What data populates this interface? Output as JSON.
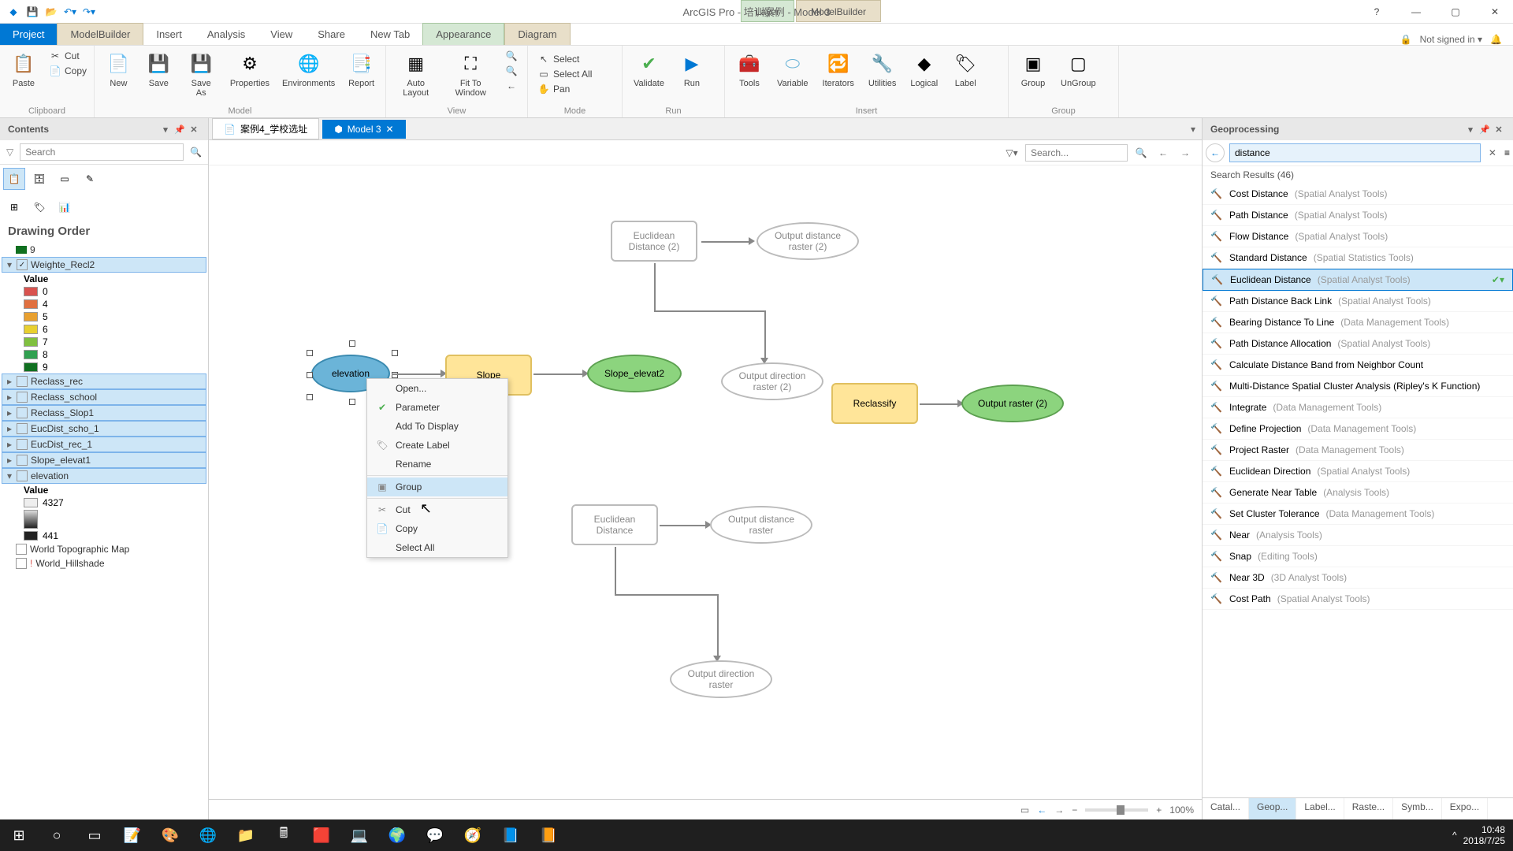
{
  "app": {
    "title": "ArcGIS Pro - 培训案例 - Model 3",
    "signin": "Not signed in ▾"
  },
  "context_tabs": {
    "layer": "Layer",
    "mb": "ModelBuilder"
  },
  "main_tabs": {
    "project": "Project",
    "modelbuilder": "ModelBuilder",
    "insert": "Insert",
    "analysis": "Analysis",
    "view": "View",
    "share": "Share",
    "newtab": "New Tab",
    "appearance": "Appearance",
    "diagram": "Diagram"
  },
  "ribbon": {
    "clipboard": {
      "paste": "Paste",
      "cut": "Cut",
      "copy": "Copy",
      "label": "Clipboard"
    },
    "model": {
      "new": "New",
      "save": "Save",
      "saveas": "Save\nAs",
      "properties": "Properties",
      "environments": "Environments",
      "report": "Report",
      "label": "Model"
    },
    "view": {
      "auto": "Auto\nLayout",
      "fit": "Fit To\nWindow",
      "label": "View"
    },
    "mode": {
      "select": "Select",
      "selectall": "Select All",
      "pan": "Pan",
      "label": "Mode"
    },
    "run": {
      "validate": "Validate",
      "run": "Run",
      "label": "Run"
    },
    "insert": {
      "tools": "Tools",
      "variable": "Variable",
      "iterators": "Iterators",
      "utilities": "Utilities",
      "logical": "Logical",
      "label_i": "Label",
      "label": "Insert"
    },
    "group": {
      "group": "Group",
      "ungroup": "UnGroup",
      "label": "Group"
    }
  },
  "contents": {
    "title": "Contents",
    "search_ph": "Search",
    "drawing": "Drawing Order",
    "top9": "9",
    "layer_weighte": "Weighte_Recl2",
    "value_label": "Value",
    "values": [
      {
        "c": "#d9534f",
        "v": "0"
      },
      {
        "c": "#e07040",
        "v": "4"
      },
      {
        "c": "#e8a030",
        "v": "5"
      },
      {
        "c": "#e8d030",
        "v": "6"
      },
      {
        "c": "#80c040",
        "v": "7"
      },
      {
        "c": "#30a050",
        "v": "8"
      },
      {
        "c": "#107020",
        "v": "9"
      }
    ],
    "layers": [
      "Reclass_rec",
      "Reclass_school",
      "Reclass_Slop1",
      "EucDist_scho_1",
      "EucDist_rec_1",
      "Slope_elevat1"
    ],
    "elev": "elevation",
    "elev_value": "Value",
    "elev_hi": "4327",
    "elev_lo": "441",
    "world_topo": "World Topographic Map",
    "world_hill": "World_Hillshade"
  },
  "doctabs": {
    "t1": "案例4_学校选址",
    "t2": "Model 3"
  },
  "canvas": {
    "search_ph": "Search...",
    "nodes": {
      "elevation": "elevation",
      "slope": "Slope",
      "slope_elev": "Slope_elevat2",
      "euc2": "Euclidean\nDistance (2)",
      "outdist2": "Output distance\nraster (2)",
      "outdir2": "Output direction\nraster (2)",
      "reclass": "Reclassify",
      "outraster2": "Output raster (2)",
      "euc": "Euclidean\nDistance",
      "outdist": "Output distance\nraster",
      "outdir": "Output direction\nraster"
    },
    "zoom": "100%"
  },
  "context_menu": {
    "open": "Open...",
    "parameter": "Parameter",
    "add": "Add To Display",
    "create": "Create Label",
    "rename": "Rename",
    "group": "Group",
    "cut": "Cut",
    "copy": "Copy",
    "selectall": "Select All"
  },
  "geop": {
    "title": "Geoprocessing",
    "search": "distance",
    "results": "Search Results (46)",
    "items": [
      {
        "name": "Cost Distance",
        "sub": "(Spatial Analyst Tools)"
      },
      {
        "name": "Path Distance",
        "sub": "(Spatial Analyst Tools)"
      },
      {
        "name": "Flow Distance",
        "sub": "(Spatial Analyst Tools)"
      },
      {
        "name": "Standard Distance",
        "sub": "(Spatial Statistics Tools)"
      },
      {
        "name": "Euclidean Distance",
        "sub": "(Spatial Analyst Tools)",
        "sel": true
      },
      {
        "name": "Path Distance Back Link",
        "sub": "(Spatial Analyst Tools)"
      },
      {
        "name": "Bearing Distance To Line",
        "sub": "(Data Management Tools)"
      },
      {
        "name": "Path Distance Allocation",
        "sub": "(Spatial Analyst Tools)"
      },
      {
        "name": "Calculate Distance Band from Neighbor Count",
        "sub": ""
      },
      {
        "name": "Multi-Distance Spatial Cluster Analysis (Ripley's K Function)",
        "sub": ""
      },
      {
        "name": "Integrate",
        "sub": "(Data Management Tools)"
      },
      {
        "name": "Define Projection",
        "sub": "(Data Management Tools)"
      },
      {
        "name": "Project Raster",
        "sub": "(Data Management Tools)"
      },
      {
        "name": "Euclidean Direction",
        "sub": "(Spatial Analyst Tools)"
      },
      {
        "name": "Generate Near Table",
        "sub": "(Analysis Tools)"
      },
      {
        "name": "Set Cluster Tolerance",
        "sub": "(Data Management Tools)"
      },
      {
        "name": "Near",
        "sub": "(Analysis Tools)"
      },
      {
        "name": "Snap",
        "sub": "(Editing Tools)"
      },
      {
        "name": "Near 3D",
        "sub": "(3D Analyst Tools)"
      },
      {
        "name": "Cost Path",
        "sub": "(Spatial Analyst Tools)"
      }
    ],
    "tabs": {
      "catalog": "Catal...",
      "geop": "Geop...",
      "label": "Label...",
      "raste": "Raste...",
      "symb": "Symb...",
      "expo": "Expo..."
    }
  },
  "taskbar": {
    "time": "10:48",
    "date": "2018/7/25"
  }
}
